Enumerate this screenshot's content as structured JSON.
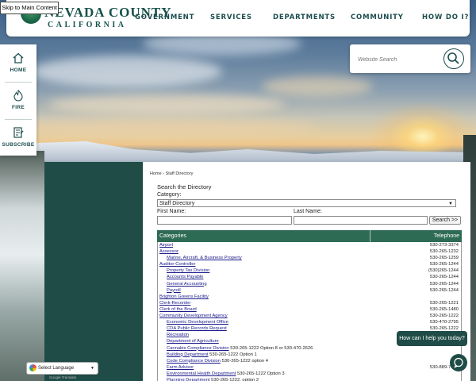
{
  "skip_link": "Skip to Main Content",
  "logo": {
    "line1": "NEVADA COUNTY",
    "line2": "CALIFORNIA"
  },
  "nav": [
    "GOVERNMENT",
    "SERVICES",
    "DEPARTMENTS",
    "COMMUNITY",
    "HOW DO I?"
  ],
  "rail": [
    {
      "label": "HOME",
      "icon": "home-icon"
    },
    {
      "label": "FIRE",
      "icon": "fire-icon"
    },
    {
      "label": "SUBSCRIBE",
      "icon": "subscribe-icon"
    }
  ],
  "site_search": {
    "placeholder": "Website Search",
    "icon": "search-icon"
  },
  "breadcrumb": {
    "home": "Home",
    "separator": "›",
    "current": "Staff Directory"
  },
  "directory_search": {
    "heading": "Search the Directory",
    "category_label": "Category:",
    "category_value": "Staff Directory",
    "first_name_label": "First Name:",
    "last_name_label": "Last Name:",
    "search_button": "Search >>"
  },
  "table": {
    "headers": {
      "categories": "Categories",
      "telephone": "Telephone"
    },
    "rows": [
      {
        "name": "Airport",
        "tel": "530-273-3374",
        "indent": false
      },
      {
        "name": "Assessor",
        "tel": "530-265-1232",
        "indent": false
      },
      {
        "name": "Marine, Aircraft, & Business Property",
        "tel": "530-265-1259",
        "indent": true
      },
      {
        "name": "Auditor-Controller",
        "tel": "530-265-1244",
        "indent": false
      },
      {
        "name": "Property Tax Division",
        "tel": "(530)265-1244",
        "indent": true
      },
      {
        "name": "Accounts Payable",
        "tel": "530-265-1244",
        "indent": true
      },
      {
        "name": "General Accounting",
        "tel": "530-265-1244",
        "indent": true
      },
      {
        "name": "Payroll",
        "tel": "530-265-1244",
        "indent": true
      },
      {
        "name": "Brighton Greens Facility",
        "tel": "",
        "indent": false
      },
      {
        "name": "Clerk-Recorder",
        "tel": "530-265-1221",
        "indent": false
      },
      {
        "name": "Clerk of the Board",
        "tel": "530-265-1480",
        "indent": false
      },
      {
        "name": "Community Development Agency",
        "tel": "530-265-1222",
        "indent": false
      },
      {
        "name": "Economic Development Office",
        "tel": "530-470-2795",
        "indent": true
      },
      {
        "name": "CDA Public Records Request",
        "tel": "530-265-1222",
        "indent": true
      },
      {
        "name": "Recreation",
        "tel": "",
        "indent": true
      },
      {
        "name": "Department of Agriculture",
        "tel": "",
        "indent": true
      },
      {
        "name": "Cannabis Compliance Division",
        "inline": "530-265-1222 Option 8 or 530-470-2626",
        "tel": "",
        "indent": true
      },
      {
        "name": "Building Department",
        "inline": "530-265-1222 Option 1",
        "tel": "",
        "indent": true
      },
      {
        "name": "Code Compliance Division",
        "inline": "530-265-1222 option 4",
        "tel": "",
        "indent": true
      },
      {
        "name": "Farm Advisor",
        "tel": "530-889-7385",
        "indent": true
      },
      {
        "name": "Environmental Health Department",
        "inline": "530-265-1222 Option 3",
        "tel": "",
        "indent": true
      },
      {
        "name": "Planning Department",
        "inline": "530-265-1222, option 2",
        "tel": "",
        "indent": true
      }
    ]
  },
  "translate": {
    "label": "Select Language",
    "powered": "Google Translate"
  },
  "chat": {
    "prompt": "How can I help you today?"
  },
  "colors": {
    "brand_green": "#1f4c46",
    "table_header": "#2e6b54",
    "link": "#1a1a8a"
  }
}
